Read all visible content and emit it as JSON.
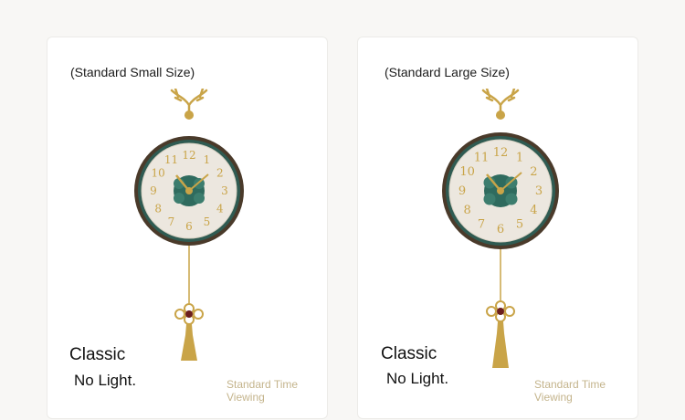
{
  "cards": [
    {
      "size_label": "(Standard Small Size)",
      "title": "Classic",
      "subtitle": "No Light.",
      "caption": "Standard Time Viewing"
    },
    {
      "size_label": "(Standard Large Size)",
      "title": "Classic",
      "subtitle": "No Light.",
      "caption": "Standard Time Viewing"
    }
  ],
  "clock_numerals": [
    "12",
    "1",
    "2",
    "3",
    "4",
    "5",
    "6",
    "7",
    "8",
    "9",
    "10",
    "11"
  ],
  "colors": {
    "gold": "#c9a448",
    "rim": "#4a3a2a",
    "dial": "#ece7df",
    "center": "#2f6b5e",
    "caption": "#c4b48c"
  },
  "icons": [
    "antler-icon",
    "wall-clock-icon",
    "pendulum-knot-icon",
    "tassel-icon"
  ]
}
